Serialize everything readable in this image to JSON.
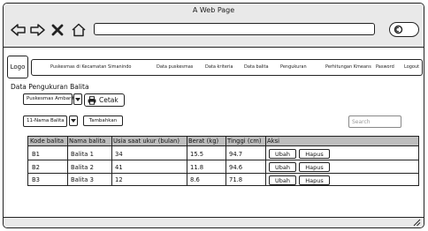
{
  "window": {
    "title": "A Web Page"
  },
  "browser": {
    "address": ""
  },
  "nav": {
    "logo": "Logo",
    "items": [
      "Puskesmas di Kecamatan Simanindo",
      "Data puskesmas",
      "Data kriteria",
      "Data balita",
      "Pengukuran",
      "Perhitungan Kmeans",
      "Pasword",
      "Logout"
    ]
  },
  "page": {
    "title": "Data Pengukuran Balita",
    "puskesmas_select": "Puskesmas Ambarita",
    "print_label": "Cetak",
    "balita_select": "11-Nama Balita",
    "add_label": "Tambahkan",
    "search_placeholder": "Search"
  },
  "table": {
    "headers": [
      "Kode balita",
      "Nama balita",
      "Usia saat ukur (bulan)",
      "Berat (kg)",
      "Tinggi (cm)",
      "Aksi"
    ],
    "rows": [
      {
        "kode": "B1",
        "nama": "Balita 1",
        "usia": "34",
        "berat": "15.5",
        "tinggi": "94.7"
      },
      {
        "kode": "B2",
        "nama": "Balita 2",
        "usia": "41",
        "berat": "11.8",
        "tinggi": "94.6"
      },
      {
        "kode": "B3",
        "nama": "Balita 3",
        "usia": "12",
        "berat": "8.6",
        "tinggi": "71.8"
      }
    ],
    "edit_label": "Ubah",
    "delete_label": "Hapus"
  },
  "icons": {
    "back": "arrow-left-icon",
    "forward": "arrow-right-icon",
    "close": "close-icon",
    "home": "home-icon",
    "search": "search-icon",
    "print": "printer-icon",
    "dropdown": "chevron-down-icon",
    "resize": "resize-grip-icon"
  }
}
